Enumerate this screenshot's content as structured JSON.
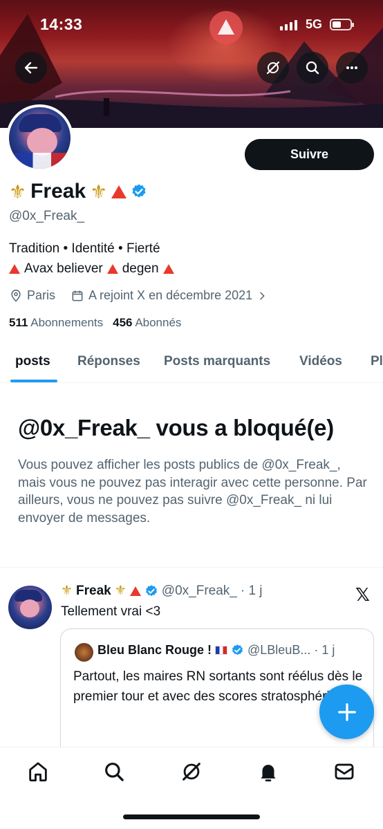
{
  "status_bar": {
    "time": "14:33",
    "network": "5G",
    "battery_level": 0.5
  },
  "banner": {
    "background_icon": "avax-logo"
  },
  "header_buttons": {
    "back": "back-arrow-icon",
    "grok": "grok-icon",
    "search": "search-icon",
    "more": "more-icon"
  },
  "profile": {
    "name": "Freak",
    "handle": "@0x_Freak_",
    "follow_label": "Suivre",
    "bio_line1": "Tradition • Identité • Fierté",
    "bio_line2_part1": "Avax believer",
    "bio_line2_part2": "degen",
    "location": "Paris",
    "joined": "A rejoint X en décembre 2021",
    "following_count": "511",
    "following_label": "Abonnements",
    "followers_count": "456",
    "followers_label": "Abonnés"
  },
  "tabs": [
    {
      "label": "posts",
      "active": true
    },
    {
      "label": "Réponses",
      "active": false
    },
    {
      "label": "Posts marquants",
      "active": false
    },
    {
      "label": "Vidéos",
      "active": false
    },
    {
      "label": "Pl",
      "active": false
    }
  ],
  "blocked": {
    "title": "@0x_Freak_ vous a bloqué(e)",
    "text": "Vous pouvez afficher les posts publics de @0x_Freak_, mais vous ne pouvez pas interagir avec cette personne. Par ailleurs, vous ne pouvez pas suivre @0x_Freak_ ni lui envoyer de messages."
  },
  "post": {
    "author": "Freak",
    "handle": "@0x_Freak_",
    "time": "· 1 j",
    "text": "Tellement vrai <3",
    "quote": {
      "author": "Bleu Blanc Rouge !",
      "handle": "@LBleuB...",
      "time": "· 1 j",
      "text": "Partout, les maires RN sortants sont réélus dès le premier tour et avec des scores stratosphériques."
    }
  },
  "colors": {
    "accent": "#1d9bf0",
    "text": "#0f1419",
    "muted": "#536471",
    "avax_red": "#e8392c",
    "lys_gold": "#c99a14"
  },
  "nav_icons": [
    "home-icon",
    "search-icon",
    "grok-icon",
    "notifications-icon",
    "messages-icon"
  ]
}
